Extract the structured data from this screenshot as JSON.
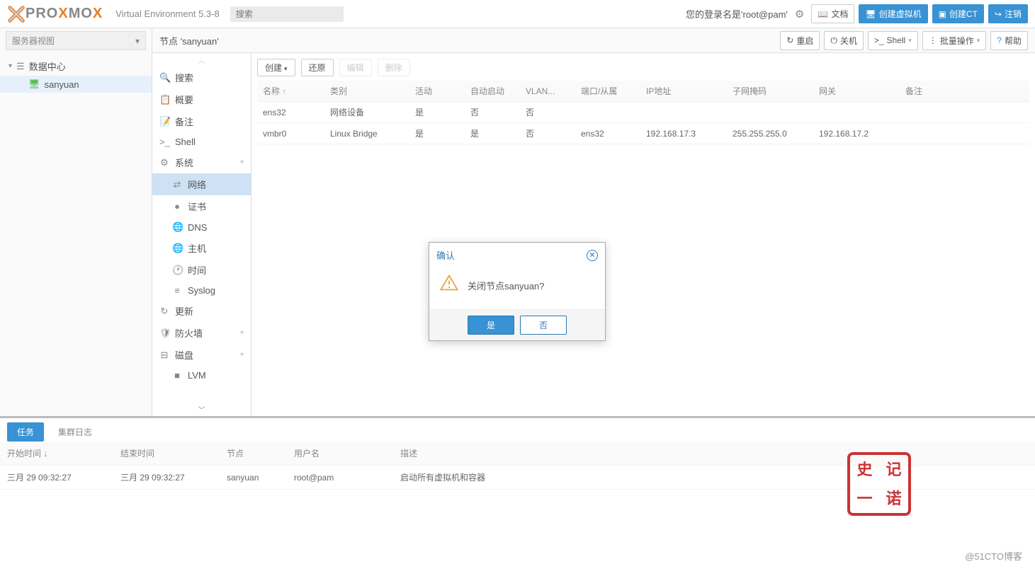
{
  "header": {
    "subtitle": "Virtual Environment 5.3-8",
    "search_placeholder": "搜索",
    "login_label": "您的登录名是'root@pam'",
    "docs_label": "文档",
    "create_vm_label": "创建虚拟机",
    "create_ct_label": "创建CT",
    "logout_label": "注销"
  },
  "left_sidebar": {
    "view_label": "服务器视图",
    "datacenter_label": "数据中心",
    "node_label": "sanyuan"
  },
  "content": {
    "title": "节点 'sanyuan'",
    "buttons": {
      "restart": "重启",
      "shutdown": "关机",
      "shell": "Shell",
      "bulk": "批量操作",
      "help": "帮助"
    },
    "subnav": [
      {
        "icon": "🔍",
        "label": "搜索",
        "child": false
      },
      {
        "icon": "📋",
        "label": "概要",
        "child": false
      },
      {
        "icon": "📝",
        "label": "备注",
        "child": false
      },
      {
        "icon": ">_",
        "label": "Shell",
        "child": false
      },
      {
        "icon": "⚙",
        "label": "系统",
        "child": false,
        "expandable": true
      },
      {
        "icon": "⇄",
        "label": "网络",
        "child": true,
        "active": true
      },
      {
        "icon": "●",
        "label": "证书",
        "child": true
      },
      {
        "icon": "🌐",
        "label": "DNS",
        "child": true
      },
      {
        "icon": "🌐",
        "label": "主机",
        "child": true
      },
      {
        "icon": "🕐",
        "label": "时间",
        "child": true
      },
      {
        "icon": "≡",
        "label": "Syslog",
        "child": true
      },
      {
        "icon": "↻",
        "label": "更新",
        "child": false
      },
      {
        "icon": "🛡",
        "label": "防火墙",
        "child": false,
        "expandable": true
      },
      {
        "icon": "⊟",
        "label": "磁盘",
        "child": false,
        "expandable": true
      },
      {
        "icon": "■",
        "label": "LVM",
        "child": true
      }
    ],
    "table": {
      "toolbar": {
        "create": "创建",
        "restore": "还原",
        "edit": "编辑",
        "delete": "删除"
      },
      "columns": [
        "名称",
        "类别",
        "活动",
        "自动启动",
        "VLAN...",
        "端口/从属",
        "IP地址",
        "子网掩码",
        "网关",
        "备注"
      ],
      "rows": [
        {
          "name": "ens32",
          "type": "网络设备",
          "active": "是",
          "auto": "否",
          "vlan": "否",
          "slave": "",
          "ip": "",
          "mask": "",
          "gateway": "",
          "note": ""
        },
        {
          "name": "vmbr0",
          "type": "Linux Bridge",
          "active": "是",
          "auto": "是",
          "vlan": "否",
          "slave": "ens32",
          "ip": "192.168.17.3",
          "mask": "255.255.255.0",
          "gateway": "192.168.17.2",
          "note": ""
        }
      ]
    }
  },
  "dialog": {
    "title": "确认",
    "message": "关闭节点sanyuan?",
    "yes": "是",
    "no": "否"
  },
  "bottom": {
    "tabs": {
      "tasks": "任务",
      "cluster_log": "集群日志"
    },
    "columns": {
      "start": "开始时间",
      "end": "结束时间",
      "node": "节点",
      "user": "用户名",
      "desc": "描述"
    },
    "rows": [
      {
        "start": "三月 29 09:32:27",
        "end": "三月 29 09:32:27",
        "node": "sanyuan",
        "user": "root@pam",
        "desc": "启动所有虚拟机和容器"
      }
    ]
  },
  "watermark": "@51CTO博客"
}
